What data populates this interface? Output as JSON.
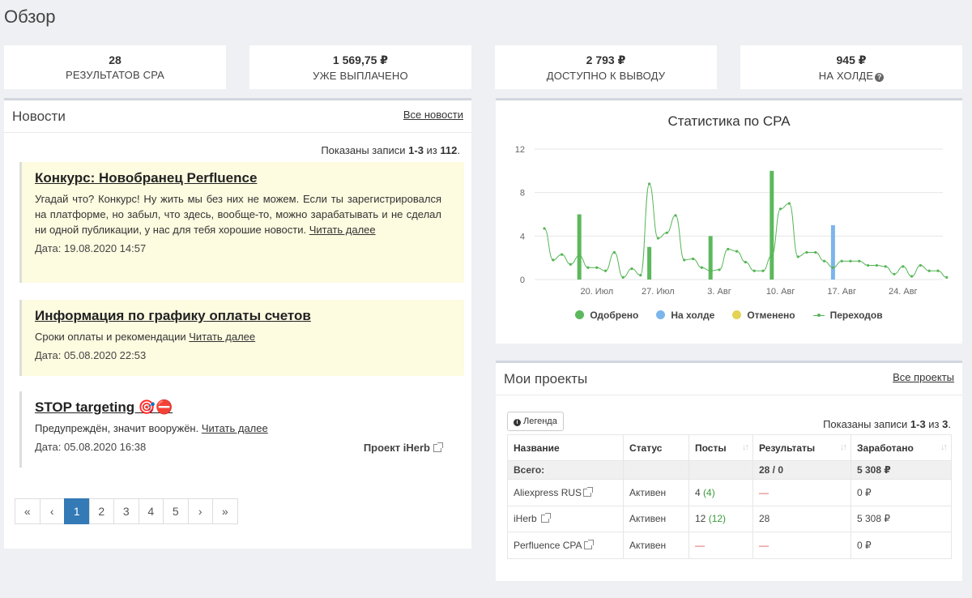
{
  "page_title": "Обзор",
  "stats": [
    {
      "value": "28",
      "label": "РЕЗУЛЬТАТОВ CPA"
    },
    {
      "value": "1 569,75 ₽",
      "label": "УЖЕ ВЫПЛАЧЕНО"
    },
    {
      "value": "2 793 ₽",
      "label": "ДОСТУПНО К ВЫВОДУ"
    },
    {
      "value": "945 ₽",
      "label": "НА ХОЛДЕ"
    }
  ],
  "news": {
    "title": "Новости",
    "all_link": "Все новости",
    "showing_prefix": "Показаны записи ",
    "showing_range": "1-3",
    "showing_mid": " из ",
    "showing_total": "112",
    "showing_suffix": ".",
    "items": [
      {
        "title": "Конкурс: Новобранец Perfluence",
        "body": "Угадай что? Конкурс! Ну жить мы без них не можем. Если ты зарегистрировался на платформе, но забыл, что здесь, вообще-то, можно зарабатывать и не сделал ни одной публикации, у нас для тебя хорошие новости. ",
        "read_more": "Читать далее",
        "date": "Дата: 19.08.2020 14:57"
      },
      {
        "title": "Информация по графику оплаты счетов",
        "body": "Сроки оплаты и рекомендации ",
        "read_more": "Читать далее",
        "date": "Дата: 05.08.2020 22:53"
      },
      {
        "title": "STOP targeting 🎯⛔",
        "body": "Предупреждён, значит вооружён. ",
        "read_more": "Читать далее",
        "date": "Дата: 05.08.2020 16:38",
        "project": "Проект iHerb"
      }
    ]
  },
  "pagination": [
    "«",
    "‹",
    "1",
    "2",
    "3",
    "4",
    "5",
    "›",
    "»"
  ],
  "chart_data": {
    "type": "bar",
    "title": "Статистика по CPA",
    "x_ticks": [
      "20. Июл",
      "27. Июл",
      "3. Авг",
      "10. Авг",
      "17. Авг",
      "24. Авг"
    ],
    "y_ticks": [
      0,
      4,
      8,
      12
    ],
    "ylim": [
      0,
      12
    ],
    "x_start": "2020-07-14",
    "bars": [
      {
        "date": "2020-07-18",
        "value": 6,
        "series": "Одобрено"
      },
      {
        "date": "2020-07-26",
        "value": 3,
        "series": "Одобрено"
      },
      {
        "date": "2020-08-02",
        "value": 4,
        "series": "Одобрено"
      },
      {
        "date": "2020-08-09",
        "value": 10,
        "series": "Одобрено"
      },
      {
        "date": "2020-08-16",
        "value": 5,
        "series": "На холде"
      }
    ],
    "line": {
      "name": "Переходов",
      "start": "2020-07-14",
      "values": [
        4.7,
        1.8,
        2.3,
        1.4,
        2.2,
        1.1,
        1.1,
        0.8,
        2.5,
        0.2,
        1.0,
        0.4,
        8.8,
        3.8,
        4.3,
        5.9,
        1.8,
        1.9,
        1.1,
        0.8,
        0.9,
        2.8,
        2.6,
        1.6,
        0.8,
        0.8,
        2.2,
        6.5,
        7.0,
        2.1,
        2.5,
        2.5,
        1.7,
        1.1,
        1.7,
        1.7,
        1.7,
        1.3,
        1.3,
        1.2,
        0.5,
        1.2,
        0.3,
        1.3,
        0.8,
        0.8,
        0.2
      ]
    },
    "legend": [
      {
        "name": "Одобрено",
        "color": "#5cb85c"
      },
      {
        "name": "На холде",
        "color": "#7cb5ec"
      },
      {
        "name": "Отменено",
        "color": "#e4d354"
      },
      {
        "name": "Переходов",
        "color": "#55b555"
      }
    ]
  },
  "projects": {
    "title": "Мои проекты",
    "all_link": "Все проекты",
    "legend_button": "Легенда",
    "showing_prefix": "Показаны записи ",
    "showing_range": "1-3",
    "showing_mid": " из ",
    "showing_total": "3",
    "showing_suffix": ".",
    "columns": [
      "Название",
      "Статус",
      "Посты",
      "Результаты",
      "Заработано"
    ],
    "total": {
      "label": "Всего:",
      "results": "28 / 0",
      "earned": "5 308 ₽"
    },
    "rows": [
      {
        "name": "Aliexpress RUS",
        "status": "Активен",
        "posts": "4",
        "posts_sub": "(4)",
        "results": "—",
        "earned": "0 ₽"
      },
      {
        "name": "iHerb",
        "status": "Активен",
        "posts": "12",
        "posts_sub": "(12)",
        "results": "28",
        "earned": "5 308 ₽"
      },
      {
        "name": "Perfluence CPA",
        "status": "Активен",
        "posts": "—",
        "posts_sub": "",
        "results": "—",
        "earned": "0 ₽"
      }
    ]
  }
}
